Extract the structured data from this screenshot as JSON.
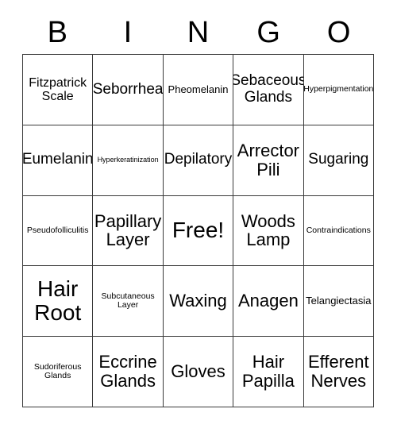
{
  "card": {
    "title": "BINGO Card",
    "headers": [
      "B",
      "I",
      "N",
      "G",
      "O"
    ],
    "free_space_label": "Free!",
    "colors": {
      "background": "#ffffff",
      "text": "#000000",
      "border": "#3a3a3a"
    },
    "rows": [
      [
        {
          "label": "Fitzpatrick Scale",
          "size": "md"
        },
        {
          "label": "Seborrhea",
          "size": "lg"
        },
        {
          "label": "Pheomelanin",
          "size": "sm"
        },
        {
          "label": "Sebaceous Glands",
          "size": "lg"
        },
        {
          "label": "Hyperpigmentation",
          "size": "xs"
        }
      ],
      [
        {
          "label": "Eumelanin",
          "size": "lg"
        },
        {
          "label": "Hyperkeratinization",
          "size": "xxs"
        },
        {
          "label": "Depilatory",
          "size": "lg"
        },
        {
          "label": "Arrector Pili",
          "size": "xl"
        },
        {
          "label": "Sugaring",
          "size": "lg"
        }
      ],
      [
        {
          "label": "Pseudofolliculitis",
          "size": "xs"
        },
        {
          "label": "Papillary Layer",
          "size": "xl"
        },
        {
          "label": "Free!",
          "size": "xxl"
        },
        {
          "label": "Woods Lamp",
          "size": "xl"
        },
        {
          "label": "Contraindications",
          "size": "xs"
        }
      ],
      [
        {
          "label": "Hair Root",
          "size": "xxl"
        },
        {
          "label": "Subcutaneous Layer",
          "size": "xs"
        },
        {
          "label": "Waxing",
          "size": "xl"
        },
        {
          "label": "Anagen",
          "size": "xl"
        },
        {
          "label": "Telangiectasia",
          "size": "sm"
        }
      ],
      [
        {
          "label": "Sudoriferous Glands",
          "size": "xs"
        },
        {
          "label": "Eccrine Glands",
          "size": "xl"
        },
        {
          "label": "Gloves",
          "size": "xl"
        },
        {
          "label": "Hair Papilla",
          "size": "xl"
        },
        {
          "label": "Efferent Nerves",
          "size": "xl"
        }
      ]
    ]
  }
}
